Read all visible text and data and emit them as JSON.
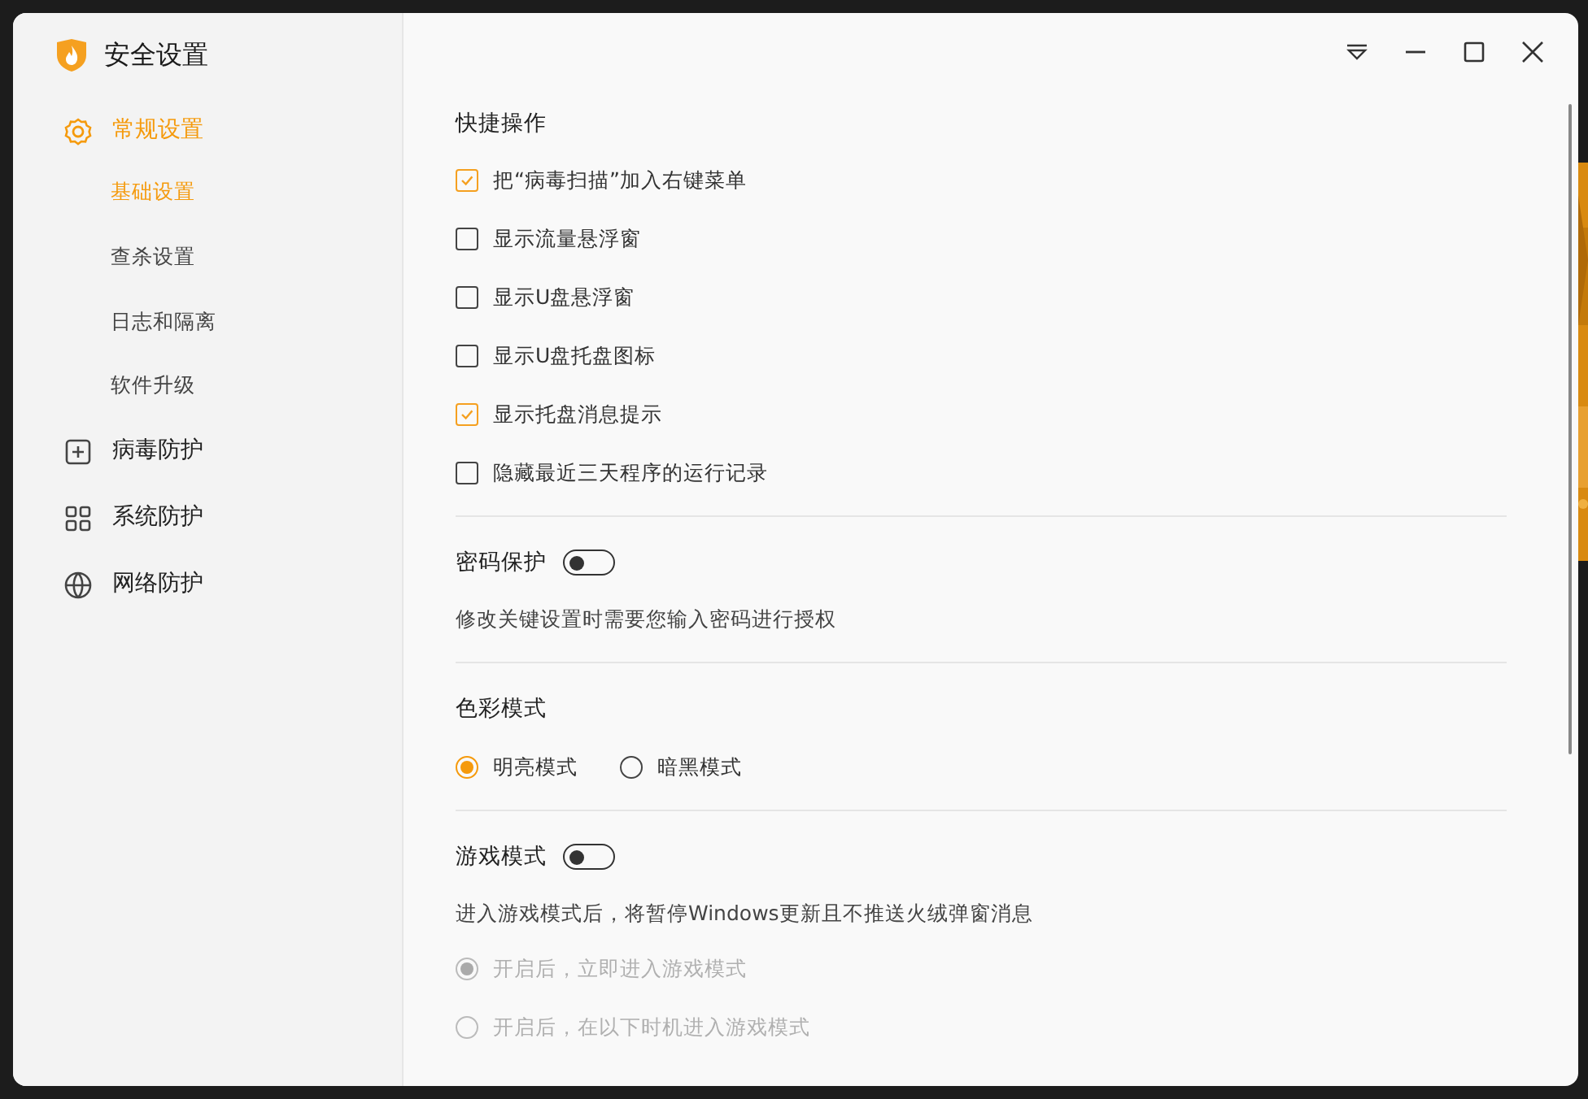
{
  "window": {
    "title": "安全设置"
  },
  "sidebar": {
    "items": [
      {
        "label": "常规设置",
        "kind": "gear",
        "selected": true,
        "children": [
          {
            "label": "基础设置",
            "selected": true
          },
          {
            "label": "查杀设置",
            "selected": false
          },
          {
            "label": "日志和隔离",
            "selected": false
          },
          {
            "label": "软件升级",
            "selected": false
          }
        ]
      },
      {
        "label": "病毒防护",
        "kind": "plus",
        "selected": false
      },
      {
        "label": "系统防护",
        "kind": "grid",
        "selected": false
      },
      {
        "label": "网络防护",
        "kind": "globe",
        "selected": false
      }
    ]
  },
  "quick_actions": {
    "title": "快捷操作",
    "options": [
      {
        "label": "把“病毒扫描”加入右键菜单",
        "checked": true
      },
      {
        "label": "显示流量悬浮窗",
        "checked": false
      },
      {
        "label": "显示U盘悬浮窗",
        "checked": false
      },
      {
        "label": "显示U盘托盘图标",
        "checked": false
      },
      {
        "label": "显示托盘消息提示",
        "checked": true
      },
      {
        "label": "隐藏最近三天程序的运行记录",
        "checked": false
      }
    ]
  },
  "password_protection": {
    "title": "密码保护",
    "on": false,
    "description": "修改关键设置时需要您输入密码进行授权"
  },
  "color_mode": {
    "title": "色彩模式",
    "options": [
      {
        "label": "明亮模式",
        "selected": true
      },
      {
        "label": "暗黑模式",
        "selected": false
      }
    ]
  },
  "game_mode": {
    "title": "游戏模式",
    "on": false,
    "description": "进入游戏模式后，将暂停Windows更新且不推送火绒弹窗消息",
    "options": [
      {
        "label": "开启后，立即进入游戏模式",
        "selected": true,
        "disabled": true
      },
      {
        "label": "开启后，在以下时机进入游戏模式",
        "selected": false,
        "disabled": true
      }
    ]
  }
}
